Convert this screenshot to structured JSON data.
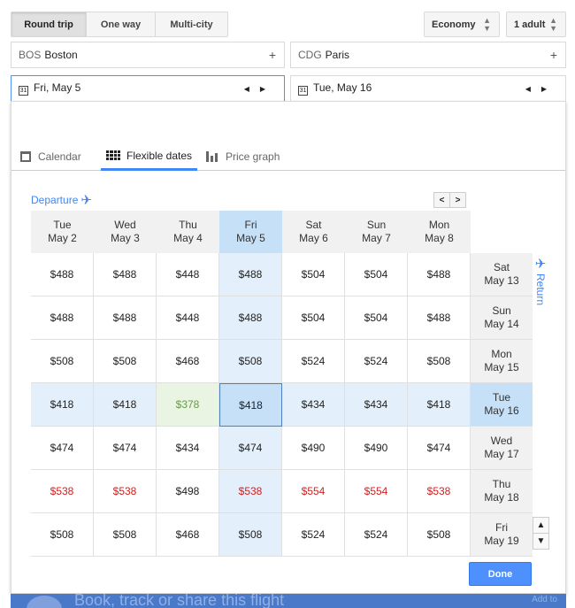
{
  "trip_tabs": [
    {
      "label": "Round trip",
      "active": true
    },
    {
      "label": "One way",
      "active": false
    },
    {
      "label": "Multi-city",
      "active": false
    }
  ],
  "cabin": "Economy",
  "passengers": "1 adult",
  "origin": {
    "code": "BOS",
    "city": "Boston"
  },
  "destination": {
    "code": "CDG",
    "city": "Paris"
  },
  "depart_date": "Fri, May 5",
  "return_date": "Tue, May 16",
  "calendar_icon_glyph": "31",
  "view_tabs": [
    {
      "label": "Calendar",
      "icon": "calendar-icon"
    },
    {
      "label": "Flexible dates",
      "icon": "grid-icon",
      "active": true
    },
    {
      "label": "Price graph",
      "icon": "bar-chart-icon"
    }
  ],
  "departure_label": "Departure",
  "return_label": "Return",
  "departure_columns": [
    {
      "day": "Tue",
      "date": "May 2"
    },
    {
      "day": "Wed",
      "date": "May 3"
    },
    {
      "day": "Thu",
      "date": "May 4"
    },
    {
      "day": "Fri",
      "date": "May 5"
    },
    {
      "day": "Sat",
      "date": "May 6"
    },
    {
      "day": "Sun",
      "date": "May 7"
    },
    {
      "day": "Mon",
      "date": "May 8"
    }
  ],
  "return_rows": [
    {
      "day": "Sat",
      "date": "May 13",
      "prices": [
        "$488",
        "$488",
        "$448",
        "$488",
        "$504",
        "$504",
        "$488"
      ]
    },
    {
      "day": "Sun",
      "date": "May 14",
      "prices": [
        "$488",
        "$488",
        "$448",
        "$488",
        "$504",
        "$504",
        "$488"
      ]
    },
    {
      "day": "Mon",
      "date": "May 15",
      "prices": [
        "$508",
        "$508",
        "$468",
        "$508",
        "$524",
        "$524",
        "$508"
      ]
    },
    {
      "day": "Tue",
      "date": "May 16",
      "prices": [
        "$418",
        "$418",
        "$378",
        "$418",
        "$434",
        "$434",
        "$418"
      ]
    },
    {
      "day": "Wed",
      "date": "May 17",
      "prices": [
        "$474",
        "$474",
        "$434",
        "$474",
        "$490",
        "$490",
        "$474"
      ]
    },
    {
      "day": "Thu",
      "date": "May 18",
      "prices": [
        "$538",
        "$538",
        "$498",
        "$538",
        "$554",
        "$554",
        "$538"
      ]
    },
    {
      "day": "Fri",
      "date": "May 19",
      "prices": [
        "$508",
        "$508",
        "$468",
        "$508",
        "$524",
        "$524",
        "$508"
      ]
    }
  ],
  "selected_column": 3,
  "selected_row": 3,
  "cheapest": {
    "row": 3,
    "col": 2
  },
  "high_price_row": 5,
  "high_price_cols": [
    0,
    1,
    3,
    4,
    5,
    6
  ],
  "done_label": "Done",
  "banner_text": "Book, track or share this flight",
  "banner_right": "Add to",
  "colors": {
    "accent": "#4285f4",
    "selected": "#c6e0f7",
    "cheap": "#6a9a4a",
    "expensive": "#d02020"
  }
}
